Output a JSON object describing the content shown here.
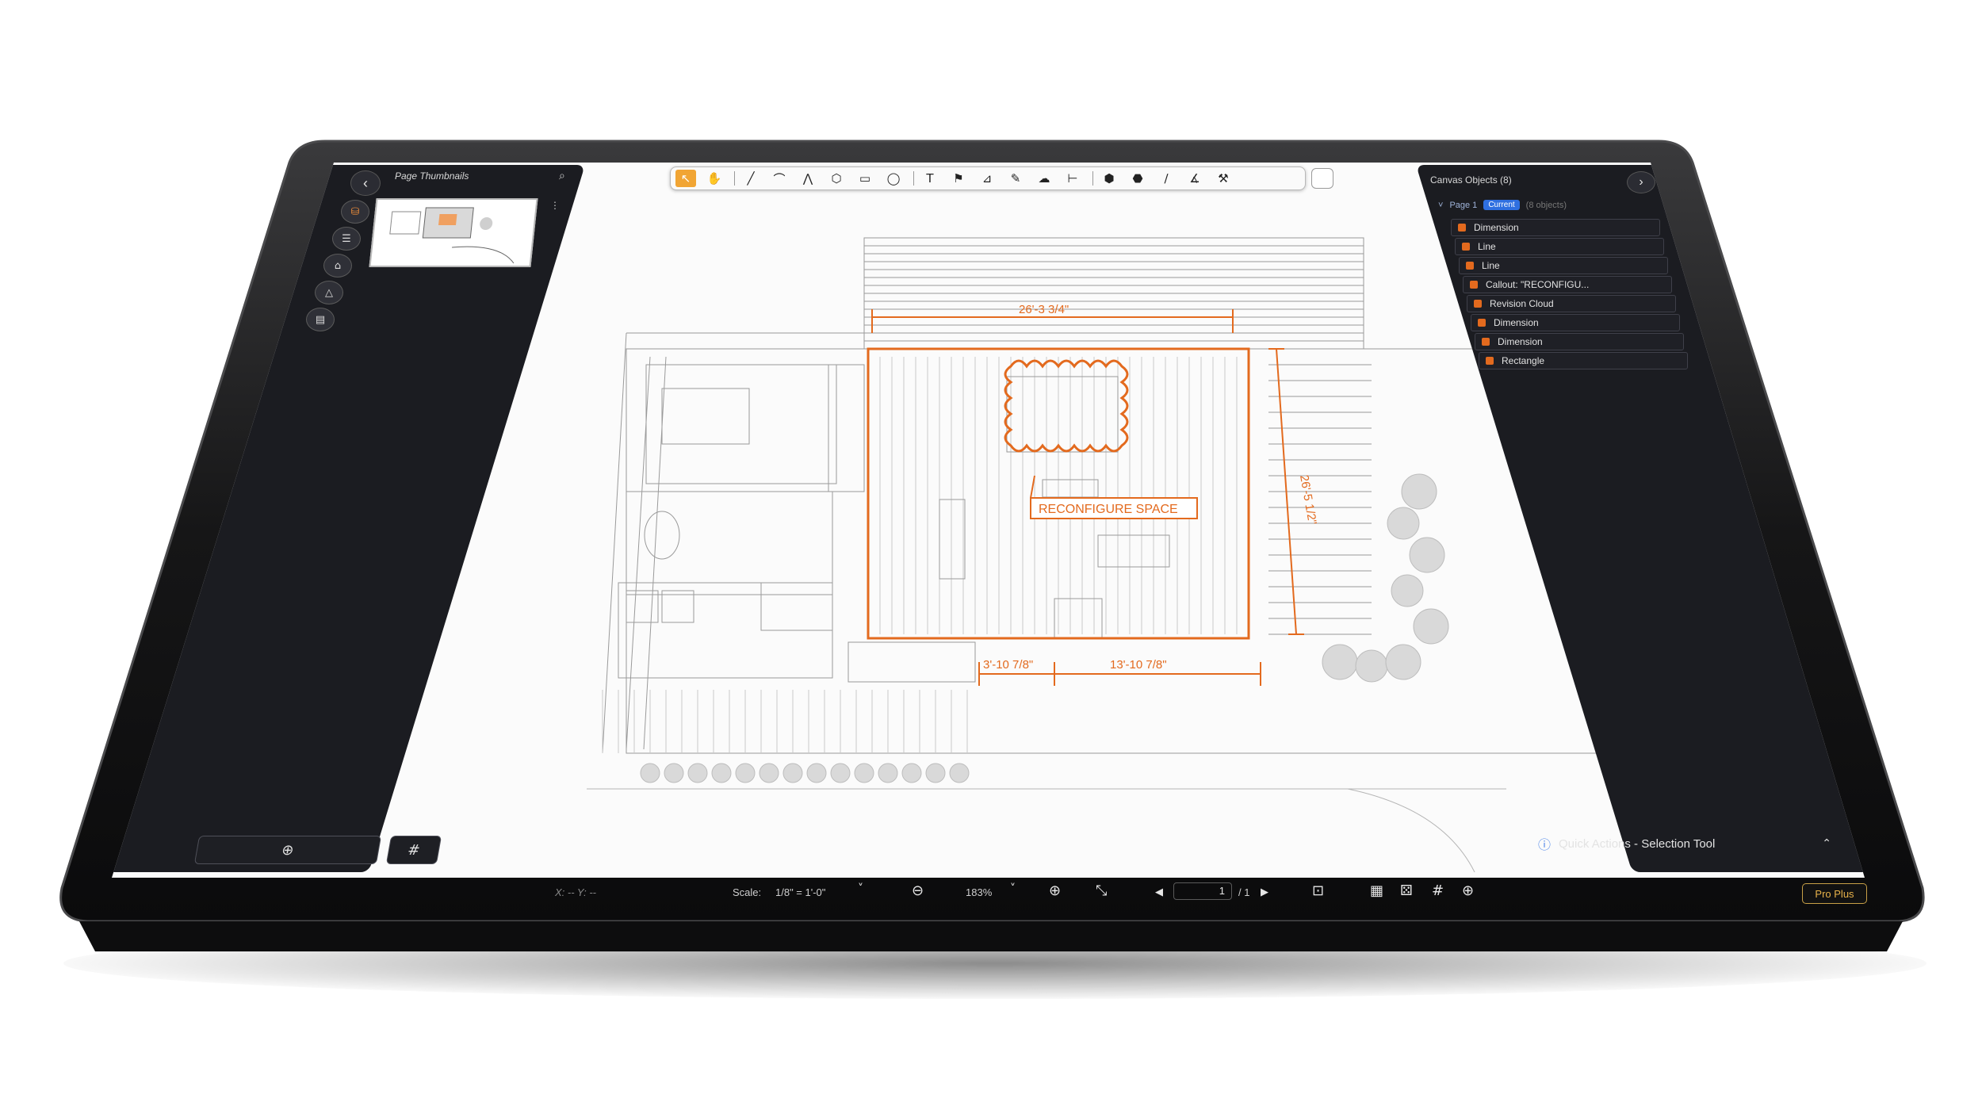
{
  "colors": {
    "accent": "#e36a1e",
    "tool_active": "#f1a534",
    "panel_bg": "#1b1c21",
    "badge_blue": "#2f6fe0",
    "pro_gold": "#e8b24a"
  },
  "toolbar": {
    "tools": [
      {
        "name": "pointer-icon",
        "glyph": "↖",
        "active": true
      },
      {
        "name": "hand-pan-icon",
        "glyph": "✋",
        "active": false
      },
      {
        "name": "line-icon",
        "glyph": "╱",
        "active": false
      },
      {
        "name": "arc-icon",
        "glyph": "⌒",
        "active": false
      },
      {
        "name": "polyline-icon",
        "glyph": "⋀",
        "active": false
      },
      {
        "name": "polygon-icon",
        "glyph": "⬡",
        "active": false
      },
      {
        "name": "rectangle-icon",
        "glyph": "▭",
        "active": false
      },
      {
        "name": "ellipse-icon",
        "glyph": "◯",
        "active": false
      },
      {
        "name": "text-icon",
        "glyph": "T",
        "active": false
      },
      {
        "name": "callout-icon",
        "glyph": "⚑",
        "active": false
      },
      {
        "name": "highlight-icon",
        "glyph": "⊿",
        "active": false
      },
      {
        "name": "pen-icon",
        "glyph": "✎",
        "active": false
      },
      {
        "name": "cloud-icon",
        "glyph": "☁",
        "active": false
      },
      {
        "name": "dimension-icon",
        "glyph": "⊢",
        "active": false
      },
      {
        "name": "area-measure-icon",
        "glyph": "⬢",
        "active": false
      },
      {
        "name": "volume-measure-icon",
        "glyph": "⬣",
        "active": false
      },
      {
        "name": "stroke-icon",
        "glyph": "∕",
        "active": false
      },
      {
        "name": "angle-icon",
        "glyph": "∡",
        "active": false
      },
      {
        "name": "calibrate-icon",
        "glyph": "⚒",
        "active": false
      }
    ]
  },
  "left_panel": {
    "title": "Page Thumbnails",
    "back_label": "‹",
    "rail_icons": [
      "layers-icon",
      "list-icon",
      "stamp-icon",
      "shape-icon",
      "document-icon"
    ],
    "add_page_glyph": "⊕",
    "numbering_glyph": "#"
  },
  "right_panel": {
    "title": "Canvas Objects (8)",
    "page_label": "Page 1",
    "current_badge": "Current",
    "object_count": "(8 objects)",
    "objects": [
      "Dimension",
      "Line",
      "Line",
      "Callout: \"RECONFIGU...",
      "Revision Cloud",
      "Dimension",
      "Dimension",
      "Rectangle"
    ],
    "quick_actions": "Quick Actions - Selection Tool"
  },
  "drawing": {
    "dim_top": "26'-3 3/4\"",
    "dim_right": "26'-5 1/2\"",
    "dim_bottom_left": "3'-10 7/8\"",
    "dim_bottom_right": "13'-10 7/8\"",
    "callout": "RECONFIGURE SPACE"
  },
  "status_bar": {
    "coords": "X:  --  Y:  --",
    "scale_label": "Scale:",
    "scale_value": "1/8\" = 1'-0\"",
    "zoom": "183%",
    "page_current": "1",
    "page_total": "/ 1",
    "plan_badge": "Pro Plus"
  }
}
